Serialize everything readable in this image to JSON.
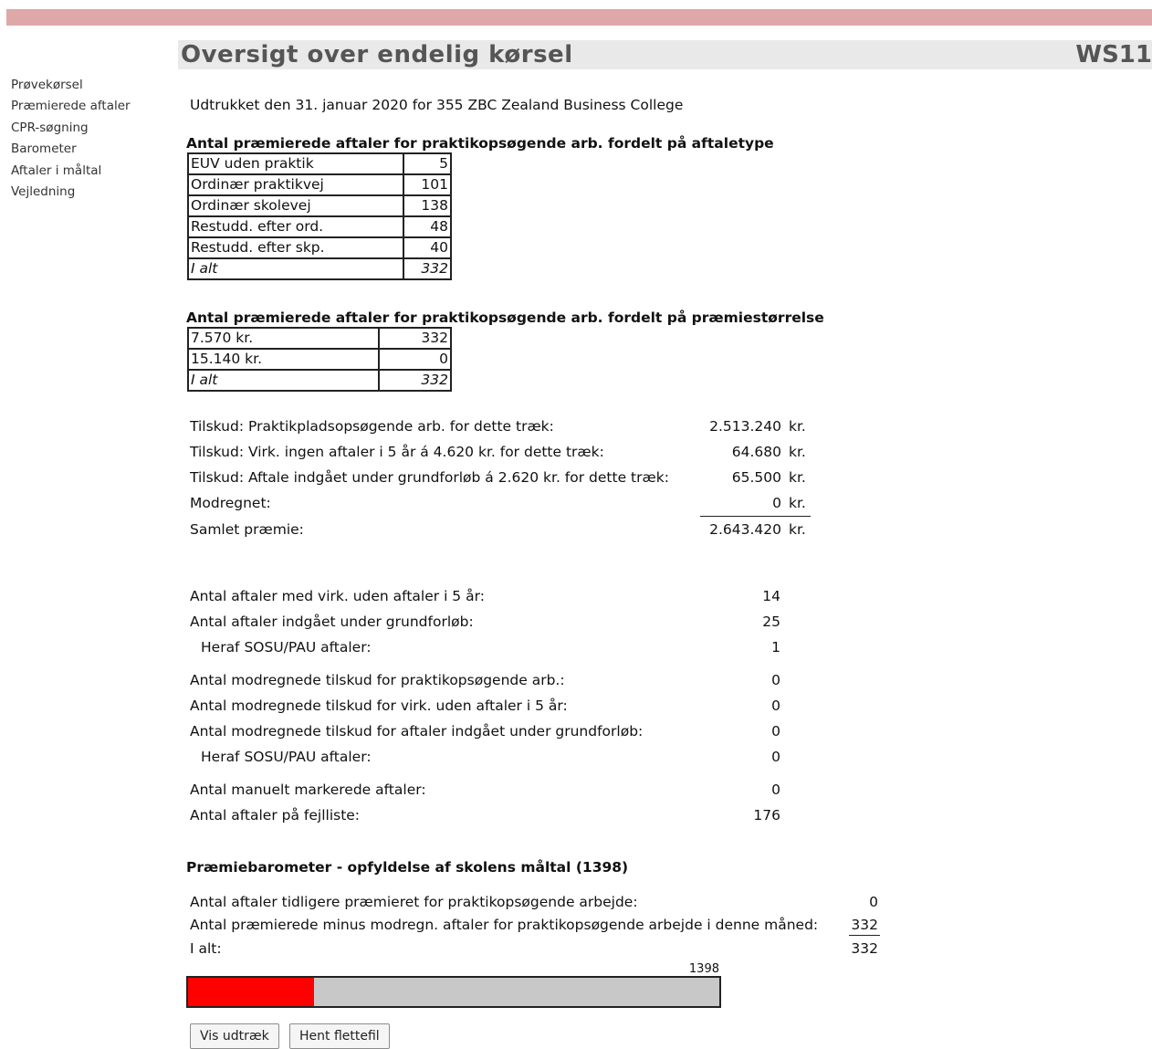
{
  "page": {
    "title": "Oversigt over endelig kørsel",
    "code": "WS11"
  },
  "sidebar": {
    "items": [
      "Prøvekørsel",
      "Præmierede aftaler",
      "CPR-søgning",
      "Barometer",
      "Aftaler i måltal",
      "Vejledning"
    ]
  },
  "subtitle": "Udtrukket den 31. januar 2020 for 355 ZBC Zealand Business College",
  "table1": {
    "heading": "Antal præmierede aftaler for praktikopsøgende arb. fordelt på aftaletype",
    "rows": [
      {
        "label": "EUV uden praktik",
        "value": "5"
      },
      {
        "label": "Ordinær praktikvej",
        "value": "101"
      },
      {
        "label": "Ordinær skolevej",
        "value": "138"
      },
      {
        "label": "Restudd. efter ord.",
        "value": "48"
      },
      {
        "label": "Restudd. efter skp.",
        "value": "40"
      },
      {
        "label": "I alt",
        "value": "332"
      }
    ]
  },
  "table2": {
    "heading": "Antal præmierede aftaler for praktikopsøgende arb. fordelt på præmiestørrelse",
    "rows": [
      {
        "label": "7.570 kr.",
        "value": "332"
      },
      {
        "label": "15.140 kr.",
        "value": "0"
      },
      {
        "label": "I alt",
        "value": "332"
      }
    ]
  },
  "subsidies": {
    "unit": "kr.",
    "rows": [
      {
        "label": "Tilskud: Praktikpladsopsøgende arb. for dette træk:",
        "value": "2.513.240"
      },
      {
        "label": "Tilskud: Virk. ingen aftaler i 5 år á 4.620 kr. for dette træk:",
        "value": "64.680"
      },
      {
        "label": "Tilskud: Aftale indgået under grundforløb á 2.620 kr. for dette træk:",
        "value": "65.500"
      },
      {
        "label": "Modregnet:",
        "value": "0"
      },
      {
        "label": "Samlet præmie:",
        "value": "2.643.420"
      }
    ]
  },
  "counts": {
    "rows": [
      {
        "label": "Antal aftaler med virk. uden aftaler i 5 år:",
        "value": "14"
      },
      {
        "label": "Antal aftaler indgået under grundforløb:",
        "value": "25"
      },
      {
        "label": "Heraf SOSU/PAU aftaler:",
        "value": "1"
      },
      {
        "label": "Antal modregnede tilskud for praktikopsøgende arb.:",
        "value": "0"
      },
      {
        "label": "Antal modregnede tilskud for virk. uden aftaler i 5 år:",
        "value": "0"
      },
      {
        "label": "Antal modregnede tilskud for aftaler indgået under grundforløb:",
        "value": "0"
      },
      {
        "label": "Heraf SOSU/PAU aftaler:",
        "value": "0"
      },
      {
        "label": "Antal manuelt markerede aftaler:",
        "value": "0"
      },
      {
        "label": "Antal aftaler på fejlliste:",
        "value": "176"
      }
    ]
  },
  "barometer": {
    "heading": "Præmiebarometer - opfyldelse af skolens måltal (1398)",
    "rows": [
      {
        "label": "Antal aftaler tidligere præmieret for praktikopsøgende arbejde:",
        "value": "0"
      },
      {
        "label": "Antal præmierede minus modregn. aftaler for praktikopsøgende arbejde i denne måned:",
        "value": "332"
      },
      {
        "label": "I alt:",
        "value": "332"
      }
    ],
    "target_label": "1398",
    "progress_value": 332,
    "target_value": 1398,
    "fill_color": "#ff0000",
    "track_color": "#c8c8c8"
  },
  "buttons": {
    "show_extract": "Vis udtræk",
    "get_merge_file": "Hent flettefil"
  }
}
